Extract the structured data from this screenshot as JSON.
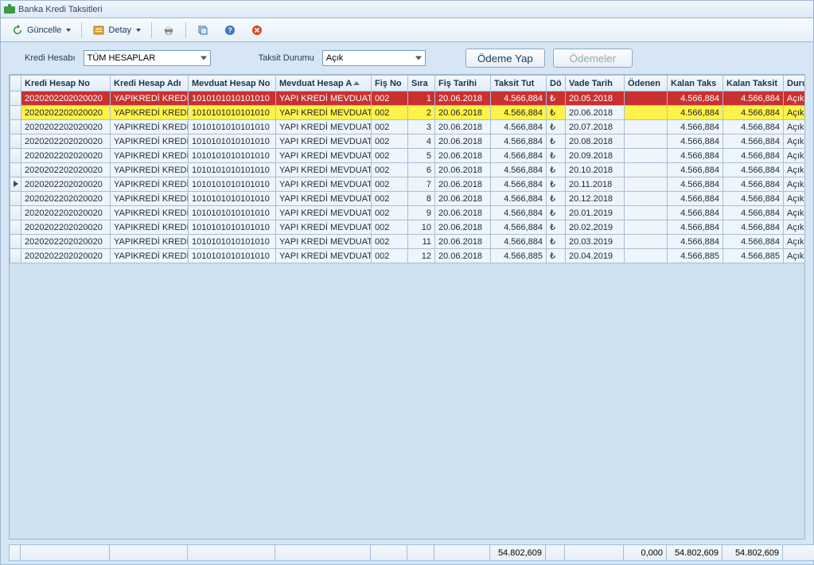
{
  "window": {
    "title": "Banka Kredi Taksitleri"
  },
  "toolbar": {
    "refresh": "Güncelle",
    "detail": "Detay"
  },
  "filters": {
    "account_label": "Kredi Hesabı",
    "account_value": "TÜM HESAPLAR",
    "status_label": "Taksit Durumu",
    "status_value": "Açık",
    "pay_btn": "Ödeme Yap",
    "payments_btn": "Ödemeler"
  },
  "columns": [
    "Kredi Hesap No",
    "Kredi Hesap Adı",
    "Mevduat Hesap No",
    "Mevduat Hesap A",
    "Fiş No",
    "Sıra",
    "Fiş Tarihi",
    "Taksit Tut",
    "Dö",
    "Vade Tarih",
    "Ödenen",
    "Kalan Taks",
    "Kalan Taksit",
    "Durumu"
  ],
  "rows": [
    {
      "style": "red",
      "kno": "2020202202020020",
      "kad": "YAPIKREDİ KREDİ H",
      "mno": "1010101010101010",
      "mad": "YAPI KREDİ MEVDUAT",
      "fis": "002",
      "sira": "1",
      "ftar": "20.06.2018",
      "tut": "4.566,884",
      "dov": "₺",
      "vade": "20.05.2018",
      "odenen": "",
      "kalan1": "4.566,884",
      "kalan2": "4.566,884",
      "dur": "Açık"
    },
    {
      "style": "yellow",
      "kno": "2020202202020020",
      "kad": "YAPIKREDİ KREDİ H",
      "mno": "1010101010101010",
      "mad": "YAPI KREDİ MEVDUAT",
      "fis": "002",
      "sira": "2",
      "ftar": "20.06.2018",
      "tut": "4.566,884",
      "dov": "₺",
      "vade": "20.06.2018",
      "odenen": "",
      "kalan1": "4.566,884",
      "kalan2": "4.566,884",
      "dur": "Açık"
    },
    {
      "style": "",
      "kno": "2020202202020020",
      "kad": "YAPIKREDİ KREDİ H",
      "mno": "1010101010101010",
      "mad": "YAPI KREDİ MEVDUAT",
      "fis": "002",
      "sira": "3",
      "ftar": "20.06.2018",
      "tut": "4.566,884",
      "dov": "₺",
      "vade": "20.07.2018",
      "odenen": "",
      "kalan1": "4.566,884",
      "kalan2": "4.566,884",
      "dur": "Açık"
    },
    {
      "style": "",
      "kno": "2020202202020020",
      "kad": "YAPIKREDİ KREDİ H",
      "mno": "1010101010101010",
      "mad": "YAPI KREDİ MEVDUAT",
      "fis": "002",
      "sira": "4",
      "ftar": "20.06.2018",
      "tut": "4.566,884",
      "dov": "₺",
      "vade": "20.08.2018",
      "odenen": "",
      "kalan1": "4.566,884",
      "kalan2": "4.566,884",
      "dur": "Açık"
    },
    {
      "style": "",
      "kno": "2020202202020020",
      "kad": "YAPIKREDİ KREDİ H",
      "mno": "1010101010101010",
      "mad": "YAPI KREDİ MEVDUAT",
      "fis": "002",
      "sira": "5",
      "ftar": "20.06.2018",
      "tut": "4.566,884",
      "dov": "₺",
      "vade": "20.09.2018",
      "odenen": "",
      "kalan1": "4.566,884",
      "kalan2": "4.566,884",
      "dur": "Açık"
    },
    {
      "style": "",
      "kno": "2020202202020020",
      "kad": "YAPIKREDİ KREDİ H",
      "mno": "1010101010101010",
      "mad": "YAPI KREDİ MEVDUAT",
      "fis": "002",
      "sira": "6",
      "ftar": "20.06.2018",
      "tut": "4.566,884",
      "dov": "₺",
      "vade": "20.10.2018",
      "odenen": "",
      "kalan1": "4.566,884",
      "kalan2": "4.566,884",
      "dur": "Açık"
    },
    {
      "style": "current",
      "kno": "2020202202020020",
      "kad": "YAPIKREDİ KREDİ H",
      "mno": "1010101010101010",
      "mad": "YAPI KREDİ MEVDUAT",
      "fis": "002",
      "sira": "7",
      "ftar": "20.06.2018",
      "tut": "4.566,884",
      "dov": "₺",
      "vade": "20.11.2018",
      "odenen": "",
      "kalan1": "4.566,884",
      "kalan2": "4.566,884",
      "dur": "Açık"
    },
    {
      "style": "",
      "kno": "2020202202020020",
      "kad": "YAPIKREDİ KREDİ H",
      "mno": "1010101010101010",
      "mad": "YAPI KREDİ MEVDUAT",
      "fis": "002",
      "sira": "8",
      "ftar": "20.06.2018",
      "tut": "4.566,884",
      "dov": "₺",
      "vade": "20.12.2018",
      "odenen": "",
      "kalan1": "4.566,884",
      "kalan2": "4.566,884",
      "dur": "Açık"
    },
    {
      "style": "",
      "kno": "2020202202020020",
      "kad": "YAPIKREDİ KREDİ H",
      "mno": "1010101010101010",
      "mad": "YAPI KREDİ MEVDUAT",
      "fis": "002",
      "sira": "9",
      "ftar": "20.06.2018",
      "tut": "4.566,884",
      "dov": "₺",
      "vade": "20.01.2019",
      "odenen": "",
      "kalan1": "4.566,884",
      "kalan2": "4.566,884",
      "dur": "Açık"
    },
    {
      "style": "",
      "kno": "2020202202020020",
      "kad": "YAPIKREDİ KREDİ H",
      "mno": "1010101010101010",
      "mad": "YAPI KREDİ MEVDUAT",
      "fis": "002",
      "sira": "10",
      "ftar": "20.06.2018",
      "tut": "4.566,884",
      "dov": "₺",
      "vade": "20.02.2019",
      "odenen": "",
      "kalan1": "4.566,884",
      "kalan2": "4.566,884",
      "dur": "Açık"
    },
    {
      "style": "",
      "kno": "2020202202020020",
      "kad": "YAPIKREDİ KREDİ H",
      "mno": "1010101010101010",
      "mad": "YAPI KREDİ MEVDUAT",
      "fis": "002",
      "sira": "11",
      "ftar": "20.06.2018",
      "tut": "4.566,884",
      "dov": "₺",
      "vade": "20.03.2019",
      "odenen": "",
      "kalan1": "4.566,884",
      "kalan2": "4.566,884",
      "dur": "Açık"
    },
    {
      "style": "",
      "kno": "2020202202020020",
      "kad": "YAPIKREDİ KREDİ H",
      "mno": "1010101010101010",
      "mad": "YAPI KREDİ MEVDUAT",
      "fis": "002",
      "sira": "12",
      "ftar": "20.06.2018",
      "tut": "4.566,885",
      "dov": "₺",
      "vade": "20.04.2019",
      "odenen": "",
      "kalan1": "4.566,885",
      "kalan2": "4.566,885",
      "dur": "Açık"
    }
  ],
  "totals": {
    "tut": "54.802,609",
    "odenen": "0,000",
    "kalan1": "54.802,609",
    "kalan2": "54.802,609"
  }
}
